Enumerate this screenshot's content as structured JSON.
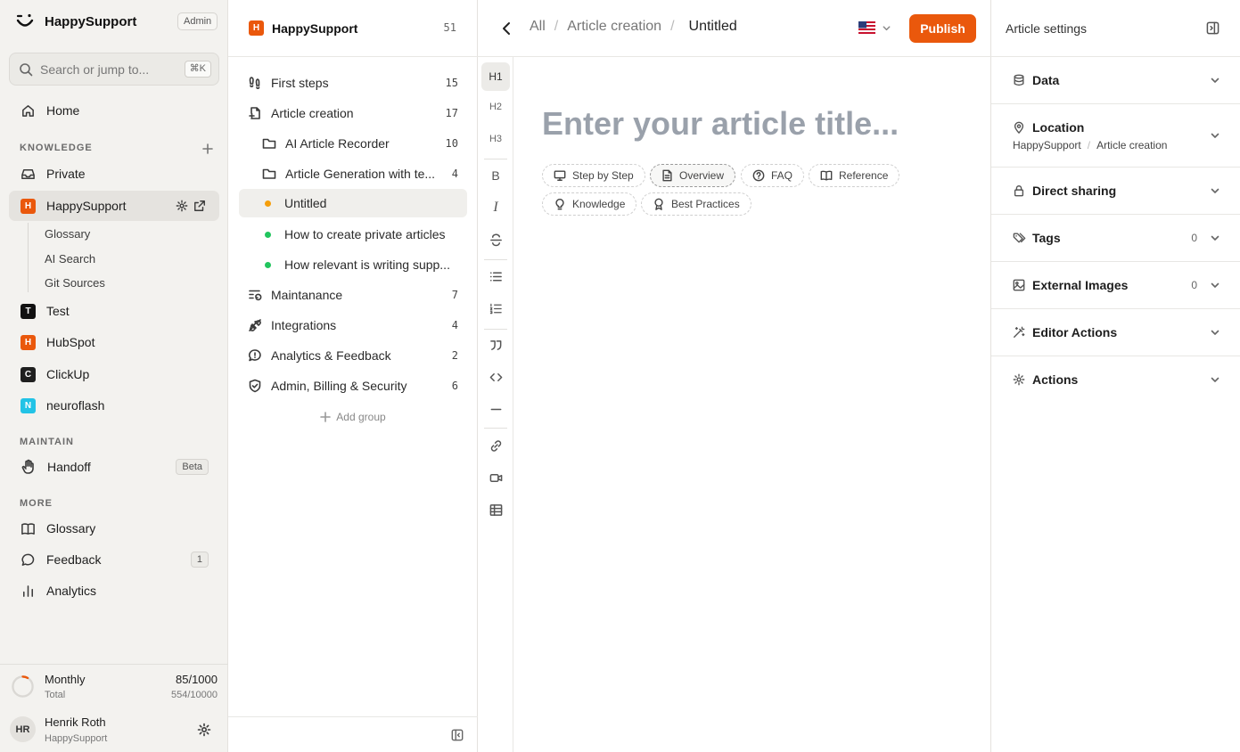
{
  "app": {
    "brand": "HappySupport",
    "role_badge": "Admin",
    "accent": "#ea580c"
  },
  "search": {
    "placeholder": "Search or jump to...",
    "shortcut": "⌘K"
  },
  "sidebar": {
    "home": "Home",
    "knowledge_label": "KNOWLEDGE",
    "private": "Private",
    "collections": [
      {
        "label": "HappySupport",
        "letter": "H",
        "color": "#ea580c"
      },
      {
        "label": "Test",
        "letter": "T",
        "color": "#111111"
      },
      {
        "label": "HubSpot",
        "letter": "H",
        "color": "#ea580c"
      },
      {
        "label": "ClickUp",
        "letter": "C",
        "color": "#1f1f1f"
      },
      {
        "label": "neuroflash",
        "letter": "N",
        "color": "#22c3e6"
      }
    ],
    "subitems": [
      "Glossary",
      "AI Search",
      "Git Sources"
    ],
    "maintain_label": "MAINTAIN",
    "handoff": "Handoff",
    "handoff_badge": "Beta",
    "more_label": "MORE",
    "glossary": "Glossary",
    "feedback": "Feedback",
    "feedback_count": "1",
    "analytics": "Analytics"
  },
  "usage": {
    "period": "Monthly",
    "period_value": "85/1000",
    "total_label": "Total",
    "total_value": "554/10000",
    "fraction": 0.085
  },
  "user": {
    "initials": "HR",
    "name": "Henrik Roth",
    "org": "HappySupport"
  },
  "tree": {
    "title": "HappySupport",
    "letter": "H",
    "total": "51",
    "rows": [
      {
        "label": "First steps",
        "count": "15"
      },
      {
        "label": "Article creation",
        "count": "17"
      },
      {
        "label": "AI Article Recorder",
        "count": "10"
      },
      {
        "label": "Article Generation with te...",
        "count": "4"
      },
      {
        "label": "Untitled",
        "count": "",
        "status": "draft"
      },
      {
        "label": "How to create private articles",
        "count": "",
        "status": "published"
      },
      {
        "label": "How relevant is writing supp...",
        "count": "",
        "status": "published"
      },
      {
        "label": "Maintanance",
        "count": "7"
      },
      {
        "label": "Integrations",
        "count": "4"
      },
      {
        "label": "Analytics & Feedback",
        "count": "2"
      },
      {
        "label": "Admin, Billing & Security",
        "count": "6"
      }
    ],
    "add_group": "Add group",
    "status_colors": {
      "draft": "#f59e0b",
      "published": "#22c55e"
    }
  },
  "editor": {
    "breadcrumb": [
      "All",
      "Article creation",
      "Untitled"
    ],
    "publish": "Publish",
    "language_flag": "us-flag",
    "title_placeholder": "Enter your article title...",
    "toolbar": {
      "h1": "H1",
      "h2": "H2",
      "h3": "H3",
      "bold": "B",
      "italic": "I"
    },
    "templates": [
      "Step by Step",
      "Overview",
      "FAQ",
      "Reference",
      "Knowledge",
      "Best Practices"
    ],
    "selected_template": "Overview"
  },
  "settings": {
    "title": "Article settings",
    "sections": [
      {
        "name": "Data",
        "icon": "database-icon"
      },
      {
        "name": "Location",
        "icon": "map-pin-icon"
      },
      {
        "name": "Direct sharing",
        "icon": "lock-icon"
      },
      {
        "name": "Tags",
        "icon": "tag-icon",
        "count": "0"
      },
      {
        "name": "External Images",
        "icon": "image-icon",
        "count": "0"
      },
      {
        "name": "Editor Actions",
        "icon": "wand-icon"
      },
      {
        "name": "Actions",
        "icon": "gear-icon"
      }
    ],
    "location_path": [
      "HappySupport",
      "Article creation"
    ]
  }
}
